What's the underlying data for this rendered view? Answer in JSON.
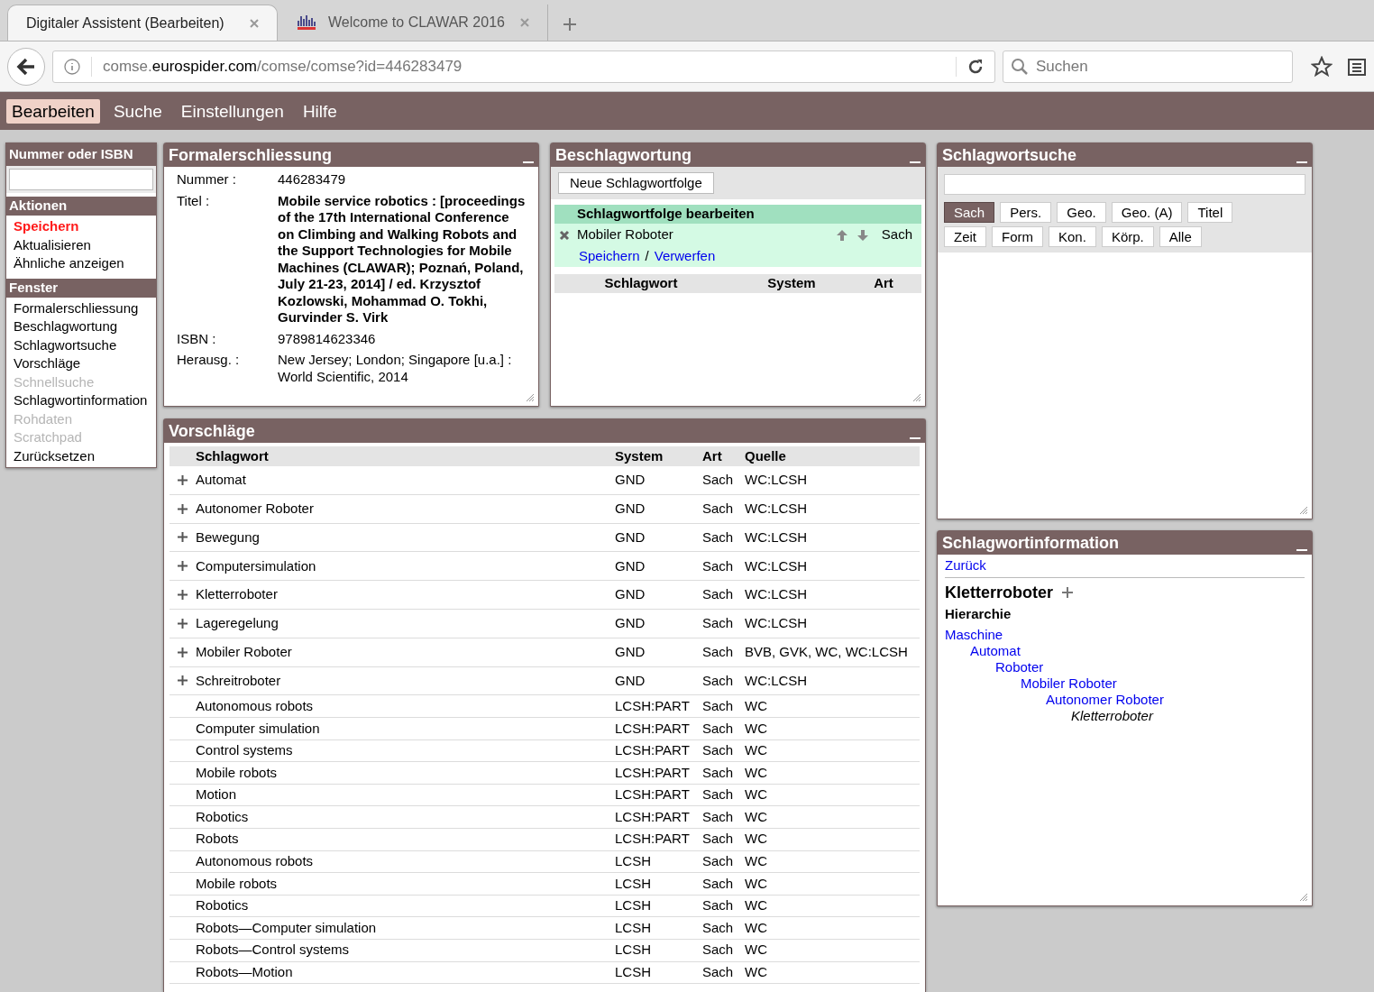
{
  "browser": {
    "tabs": [
      {
        "title": "Digitaler Assistent (Bearbeiten)",
        "selected": true,
        "has_logo": false
      },
      {
        "title": "Welcome to CLAWAR 2016",
        "selected": false,
        "has_logo": true
      }
    ],
    "url": {
      "host_prefix": "comse.",
      "domain": "eurospider.com",
      "path": "/comse/comse?id=446283479"
    },
    "search": {
      "placeholder": "Suchen"
    }
  },
  "menu": [
    {
      "label": "Bearbeiten",
      "selected": true
    },
    {
      "label": "Suche",
      "selected": false
    },
    {
      "label": "Einstellungen",
      "selected": false
    },
    {
      "label": "Hilfe",
      "selected": false
    }
  ],
  "sidebar": {
    "number_title": "Nummer oder ISBN",
    "sections": [
      {
        "title": "Aktionen",
        "items": [
          {
            "label": "Speichern",
            "emphasized": true,
            "disabled": false
          },
          {
            "label": "Aktualisieren",
            "emphasized": false,
            "disabled": false
          },
          {
            "label": "Ähnliche anzeigen",
            "emphasized": false,
            "disabled": false
          }
        ]
      },
      {
        "title": "Fenster",
        "items": [
          {
            "label": "Formalerschliessung",
            "emphasized": false,
            "disabled": false
          },
          {
            "label": "Beschlagwortung",
            "emphasized": false,
            "disabled": false
          },
          {
            "label": "Schlagwortsuche",
            "emphasized": false,
            "disabled": false
          },
          {
            "label": "Vorschläge",
            "emphasized": false,
            "disabled": false
          },
          {
            "label": "Schnellsuche",
            "emphasized": false,
            "disabled": true
          },
          {
            "label": "Schlagwortinformation",
            "emphasized": false,
            "disabled": false
          },
          {
            "label": "Rohdaten",
            "emphasized": false,
            "disabled": true
          },
          {
            "label": "Scratchpad",
            "emphasized": false,
            "disabled": true
          },
          {
            "label": "Zurücksetzen",
            "emphasized": false,
            "disabled": false
          }
        ]
      }
    ]
  },
  "formal": {
    "title": "Formalerschliessung",
    "fields": [
      {
        "label": "Nummer :",
        "value": "446283479",
        "bold": false
      },
      {
        "label": "Titel :",
        "value": "Mobile service robotics : [proceedings of the 17th International Conference on Climbing and Walking Robots and the Support Technologies for Mobile Machines (CLAWAR); Poznań, Poland, July 21-23, 2014] / ed. Krzysztof Kozlowski, Mohammad O. Tokhi, Gurvinder S. Virk",
        "bold": true
      },
      {
        "label": "ISBN :",
        "value": "9789814623346",
        "bold": false
      },
      {
        "label": "Herausg. :",
        "value": "New Jersey; London; Singapore [u.a.] : World Scientific, 2014",
        "bold": false
      }
    ]
  },
  "beschlag": {
    "title": "Beschlagwortung",
    "new_button": "Neue Schlagwortfolge",
    "edit_title": "Schlagwortfolge bearbeiten",
    "entry": {
      "term": "Mobiler Roboter",
      "type": "Sach"
    },
    "save": "Speichern",
    "separator": "/",
    "discard": "Verwerfen",
    "columns": [
      "Schlagwort",
      "System",
      "Art"
    ]
  },
  "suche": {
    "title": "Schlagwortsuche",
    "filters": [
      {
        "label": "Sach",
        "selected": true
      },
      {
        "label": "Pers.",
        "selected": false
      },
      {
        "label": "Geo.",
        "selected": false
      },
      {
        "label": "Geo. (A)",
        "selected": false
      },
      {
        "label": "Titel",
        "selected": false
      },
      {
        "label": "Zeit",
        "selected": false
      },
      {
        "label": "Form",
        "selected": false
      },
      {
        "label": "Kon.",
        "selected": false
      },
      {
        "label": "Körp.",
        "selected": false
      },
      {
        "label": "Alle",
        "selected": false
      }
    ]
  },
  "vorschlaege": {
    "title": "Vorschläge",
    "columns": [
      "Schlagwort",
      "System",
      "Art",
      "Quelle"
    ],
    "rows": [
      {
        "term": "Automat",
        "system": "GND",
        "type": "Sach",
        "source": "WC:LCSH",
        "addable": true
      },
      {
        "term": "Autonomer Roboter",
        "system": "GND",
        "type": "Sach",
        "source": "WC:LCSH",
        "addable": true
      },
      {
        "term": "Bewegung",
        "system": "GND",
        "type": "Sach",
        "source": "WC:LCSH",
        "addable": true
      },
      {
        "term": "Computersimulation",
        "system": "GND",
        "type": "Sach",
        "source": "WC:LCSH",
        "addable": true
      },
      {
        "term": "Kletterroboter",
        "system": "GND",
        "type": "Sach",
        "source": "WC:LCSH",
        "addable": true
      },
      {
        "term": "Lageregelung",
        "system": "GND",
        "type": "Sach",
        "source": "WC:LCSH",
        "addable": true
      },
      {
        "term": "Mobiler Roboter",
        "system": "GND",
        "type": "Sach",
        "source": "BVB, GVK, WC, WC:LCSH",
        "addable": true
      },
      {
        "term": "Schreitroboter",
        "system": "GND",
        "type": "Sach",
        "source": "WC:LCSH",
        "addable": true
      },
      {
        "term": "Autonomous robots",
        "system": "LCSH:PART",
        "type": "Sach",
        "source": "WC",
        "addable": false
      },
      {
        "term": "Computer simulation",
        "system": "LCSH:PART",
        "type": "Sach",
        "source": "WC",
        "addable": false
      },
      {
        "term": "Control systems",
        "system": "LCSH:PART",
        "type": "Sach",
        "source": "WC",
        "addable": false
      },
      {
        "term": "Mobile robots",
        "system": "LCSH:PART",
        "type": "Sach",
        "source": "WC",
        "addable": false
      },
      {
        "term": "Motion",
        "system": "LCSH:PART",
        "type": "Sach",
        "source": "WC",
        "addable": false
      },
      {
        "term": "Robotics",
        "system": "LCSH:PART",
        "type": "Sach",
        "source": "WC",
        "addable": false
      },
      {
        "term": "Robots",
        "system": "LCSH:PART",
        "type": "Sach",
        "source": "WC",
        "addable": false
      },
      {
        "term": "Autonomous robots",
        "system": "LCSH",
        "type": "Sach",
        "source": "WC",
        "addable": false
      },
      {
        "term": "Mobile robots",
        "system": "LCSH",
        "type": "Sach",
        "source": "WC",
        "addable": false
      },
      {
        "term": "Robotics",
        "system": "LCSH",
        "type": "Sach",
        "source": "WC",
        "addable": false
      },
      {
        "term": "Robots—Computer simulation",
        "system": "LCSH",
        "type": "Sach",
        "source": "WC",
        "addable": false
      },
      {
        "term": "Robots—Control systems",
        "system": "LCSH",
        "type": "Sach",
        "source": "WC",
        "addable": false
      },
      {
        "term": "Robots—Motion",
        "system": "LCSH",
        "type": "Sach",
        "source": "WC",
        "addable": false
      }
    ]
  },
  "info": {
    "title": "Schlagwortinformation",
    "back": "Zurück",
    "term": "Kletterroboter",
    "hierarchy_title": "Hierarchie",
    "hierarchy": [
      {
        "label": "Maschine",
        "current": false,
        "children": [
          {
            "label": "Automat",
            "current": false,
            "children": [
              {
                "label": "Roboter",
                "current": false,
                "children": [
                  {
                    "label": "Mobiler Roboter",
                    "current": false,
                    "children": [
                      {
                        "label": "Autonomer Roboter",
                        "current": false,
                        "children": [
                          {
                            "label": "Kletterroboter",
                            "current": true
                          }
                        ]
                      }
                    ]
                  }
                ]
              }
            ]
          }
        ]
      }
    ]
  }
}
